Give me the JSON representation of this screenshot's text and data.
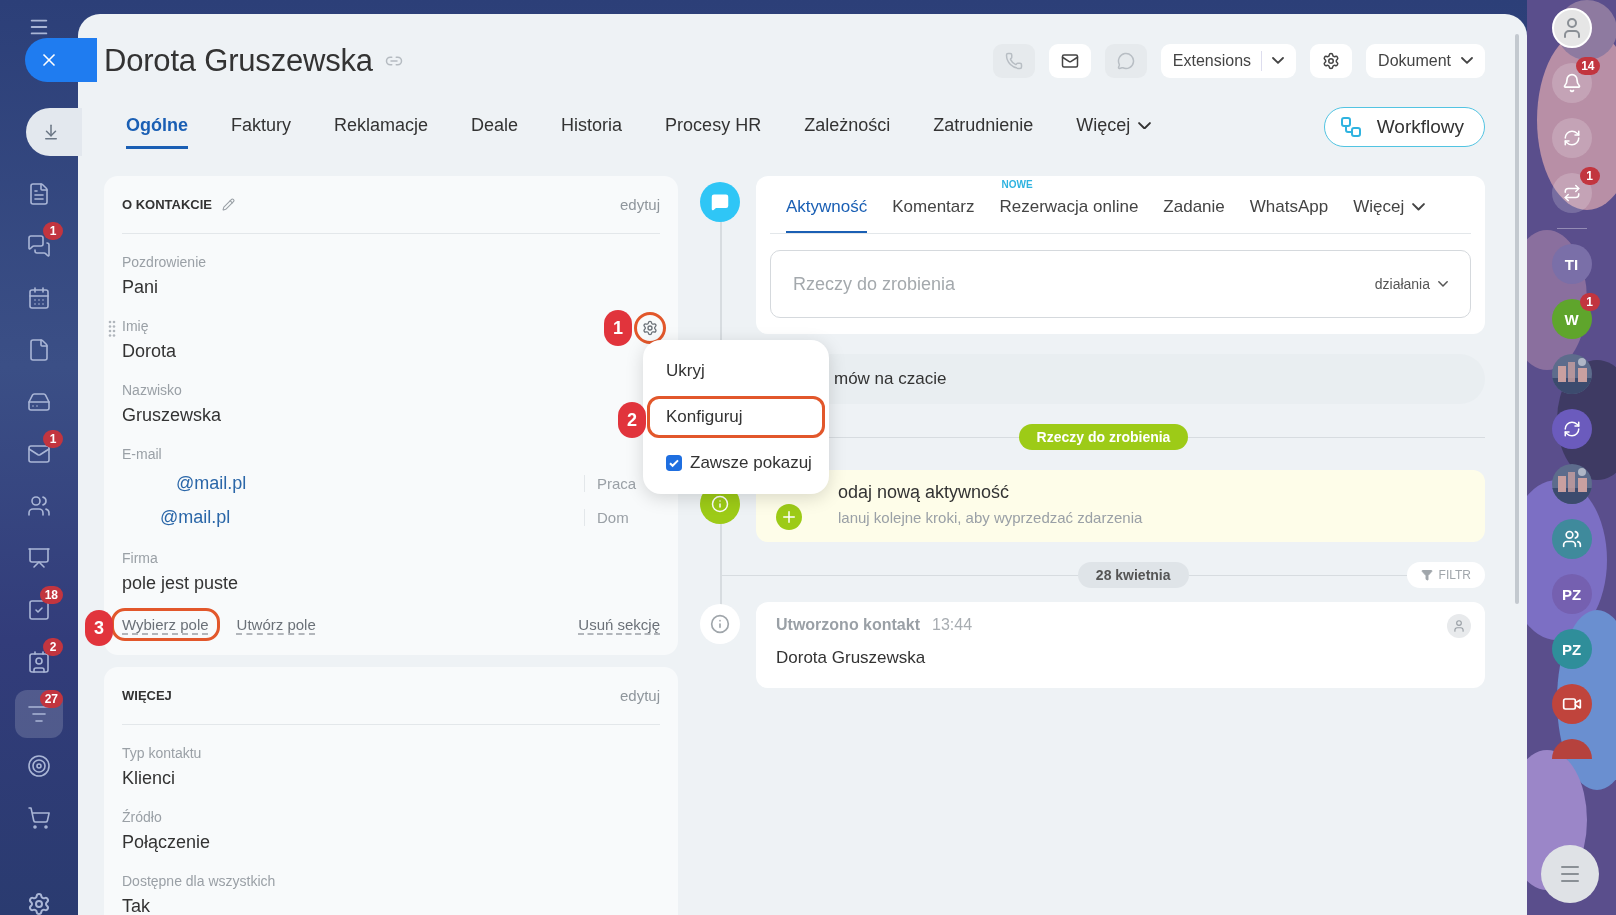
{
  "nav": {
    "items": [
      {
        "selected": false
      },
      {
        "selected": false,
        "badge": "1"
      },
      {
        "selected": false
      },
      {
        "selected": false
      },
      {
        "selected": false
      },
      {
        "selected": false,
        "badge": "1"
      },
      {
        "selected": false
      },
      {
        "selected": false
      },
      {
        "selected": false,
        "badge": "18"
      },
      {
        "selected": false,
        "badge": "2"
      },
      {
        "selected": true,
        "badge": "27"
      },
      {
        "selected": false
      },
      {
        "selected": false
      }
    ]
  },
  "header": {
    "title": "Dorota Gruszewska",
    "actions": [
      {
        "kind": "call",
        "disabled": true
      },
      {
        "kind": "mail",
        "disabled": false
      },
      {
        "kind": "chat",
        "disabled": true
      }
    ],
    "extensions": "Extensions",
    "document": "Dokument"
  },
  "tabs": [
    {
      "label": "Ogólne",
      "selected": true
    },
    {
      "label": "Faktury",
      "selected": false
    },
    {
      "label": "Reklamacje",
      "selected": false
    },
    {
      "label": "Deale",
      "selected": false
    },
    {
      "label": "Historia",
      "selected": false
    },
    {
      "label": "Procesy HR",
      "selected": false
    },
    {
      "label": "Zależności",
      "selected": false
    },
    {
      "label": "Zatrudnienie",
      "selected": false
    },
    {
      "label": "Więcej",
      "selected": false,
      "dropdown": true
    }
  ],
  "workflow_button": "Workflowy",
  "cards": [
    {
      "title": "O KONTAKCIE",
      "editable_title": true,
      "edit": "edytuj",
      "fields": [
        {
          "kind": "text",
          "label": "Pozdrowienie",
          "value": "Pani"
        },
        {
          "kind": "text",
          "label": "Imię",
          "value": "Dorota",
          "hovered": true
        },
        {
          "kind": "text",
          "label": "Nazwisko",
          "value": "Gruszewska"
        },
        {
          "kind": "emails",
          "label": "E-mail",
          "values": [
            {
              "value": "@mail.pl",
              "type": "Praca"
            },
            {
              "value": "@mail.pl",
              "type": "Dom"
            }
          ]
        },
        {
          "kind": "text",
          "label": "Firma",
          "value": "pole jest puste"
        }
      ],
      "footer": {
        "links": [
          {
            "label": "Wybierz pole",
            "highlighted": true
          },
          {
            "label": "Utwórz pole",
            "highlighted": false
          }
        ],
        "remove": "Usuń sekcję"
      }
    },
    {
      "title": "WIĘCEJ",
      "editable_title": false,
      "edit": "edytuj",
      "fields": [
        {
          "kind": "text",
          "label": "Typ kontaktu",
          "value": "Klienci"
        },
        {
          "kind": "text",
          "label": "Źródło",
          "value": "Połączenie"
        },
        {
          "kind": "text",
          "label": "Dostępne dla wszystkich",
          "value": "Tak"
        }
      ]
    }
  ],
  "field_menu": {
    "items": [
      {
        "kind": "action",
        "label": "Ukryj",
        "highlighted": false
      },
      {
        "kind": "action",
        "label": "Konfiguruj",
        "highlighted": true
      },
      {
        "kind": "checkbox",
        "label": "Zawsze pokazuj",
        "checked": true
      }
    ]
  },
  "annotations": [
    "1",
    "2",
    "3"
  ],
  "composer": {
    "tabs": [
      {
        "label": "Aktywność",
        "selected": true
      },
      {
        "label": "Komentarz",
        "selected": false
      },
      {
        "label": "Rezerwacja online",
        "selected": false,
        "badge": "NOWE"
      },
      {
        "label": "Zadanie",
        "selected": false
      },
      {
        "label": "WhatsApp",
        "selected": false
      },
      {
        "label": "Więcej",
        "selected": false,
        "dropdown": true
      }
    ],
    "placeholder": "Rzeczy do zrobienia",
    "actions": "działania"
  },
  "feed": {
    "chat_prompt": "mów na czacie",
    "section": "Rzeczy do zrobienia",
    "todo": {
      "title": "odaj nową aktywność",
      "subtitle": "lanuj kolejne kroki, aby wyprzedzać zdarzenia"
    },
    "date": "28 kwietnia",
    "filter": "FILTR",
    "entry": {
      "title": "Utworzono kontakt",
      "time": "13:44",
      "body": "Dorota Gruszewska"
    }
  },
  "rightbar": {
    "items": [
      {
        "kind": "avatar"
      },
      {
        "kind": "bell",
        "badge": "14"
      },
      {
        "kind": "ring"
      },
      {
        "kind": "chat",
        "badge": "1"
      },
      {
        "kind": "divider"
      },
      {
        "kind": "initials",
        "label": "TI",
        "color": "#7a6fa8"
      },
      {
        "kind": "initials",
        "label": "W",
        "color": "#5fa52c",
        "badge": "1"
      },
      {
        "kind": "picture"
      },
      {
        "kind": "ring",
        "color": "#6b5bbd"
      },
      {
        "kind": "picture"
      },
      {
        "kind": "group",
        "color": "#3f8a9c"
      },
      {
        "kind": "initials",
        "label": "PZ",
        "color": "#7560b0"
      },
      {
        "kind": "initials",
        "label": "PZ",
        "color": "#2f8e9a"
      },
      {
        "kind": "video",
        "color": "#c0443c"
      },
      {
        "kind": "partial",
        "color": "#b6423d"
      }
    ]
  }
}
